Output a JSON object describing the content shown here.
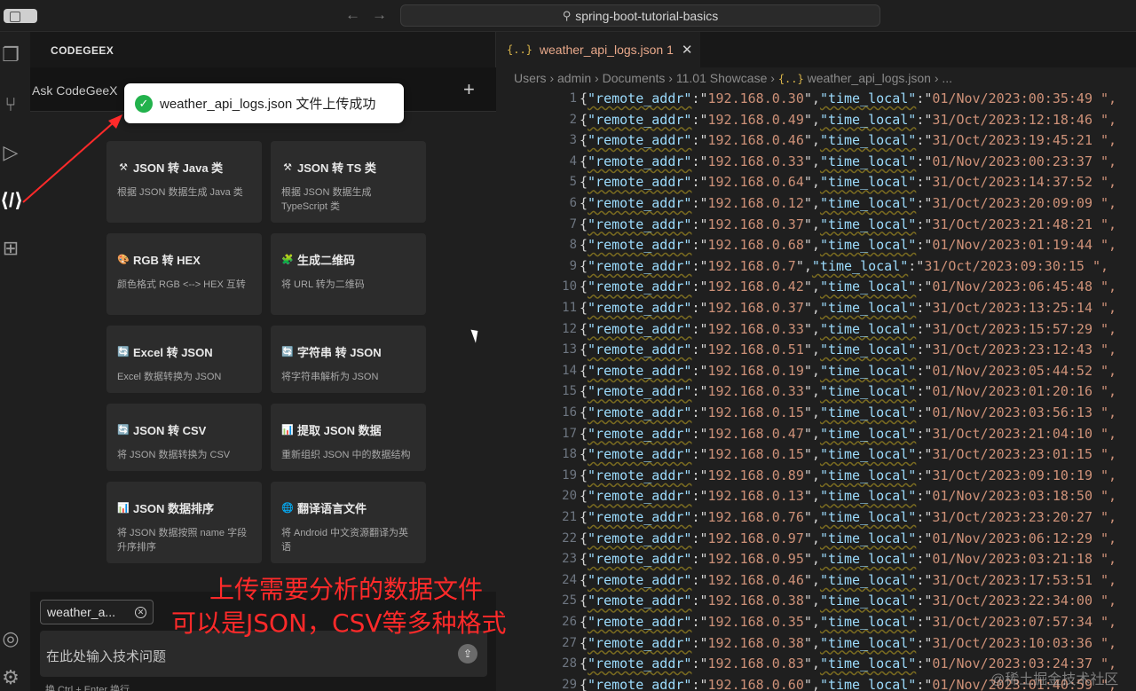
{
  "titlebar": {
    "search_text": "spring-boot-tutorial-basics",
    "back_icon": "arrow-left-icon",
    "forward_icon": "arrow-right-icon"
  },
  "sidebar": {
    "title": "CODEGEEX",
    "ask_label": "Ask CodeGeeX",
    "new_chat": "+"
  },
  "toast": {
    "message": "weather_api_logs.json 文件上传成功",
    "icon": "check-circle-icon"
  },
  "cards": [
    {
      "icon": "⚒",
      "title": "JSON 转 Java 类",
      "desc": "根据 JSON 数据生成 Java 类"
    },
    {
      "icon": "⚒",
      "title": "JSON 转 TS 类",
      "desc": "根据 JSON 数据生成 TypeScript 类"
    },
    {
      "icon": "🎨",
      "title": "RGB 转 HEX",
      "desc": "颜色格式 RGB <--> HEX 互转"
    },
    {
      "icon": "🧩",
      "title": "生成二维码",
      "desc": "将 URL 转为二维码"
    },
    {
      "icon": "🔄",
      "title": "Excel 转 JSON",
      "desc": "Excel 数据转换为 JSON"
    },
    {
      "icon": "🔄",
      "title": "字符串 转 JSON",
      "desc": "将字符串解析为 JSON"
    },
    {
      "icon": "🔄",
      "title": "JSON 转 CSV",
      "desc": "将 JSON 数据转换为 CSV"
    },
    {
      "icon": "📊",
      "title": "提取 JSON 数据",
      "desc": "重新组织 JSON 中的数据结构"
    },
    {
      "icon": "📊",
      "title": "JSON 数据排序",
      "desc": "将 JSON 数据按照 name 字段升序排序"
    },
    {
      "icon": "🌐",
      "title": "翻译语言文件",
      "desc": "将 Android 中文资源翻译为英语"
    }
  ],
  "input": {
    "file_chip": "weather_a...",
    "placeholder": "在此处输入技术问题",
    "hint": "换 Ctrl + Enter 换行"
  },
  "overlay": {
    "line1": "上传需要分析的数据文件",
    "line2": "可以是JSON，CSV等多种格式"
  },
  "editor": {
    "tab_label": "weather_api_logs.json 1",
    "breadcrumb": [
      "Users",
      "admin",
      "Documents",
      "11.01 Showcase",
      "weather_api_logs.json",
      "..."
    ],
    "lines": [
      {
        "n": "1",
        "addr": "192.168.0.30",
        "time": "01/Nov/2023:00:35:49"
      },
      {
        "n": "2",
        "addr": "192.168.0.49",
        "time": "31/Oct/2023:12:18:46"
      },
      {
        "n": "3",
        "addr": "192.168.0.46",
        "time": "31/Oct/2023:19:45:21"
      },
      {
        "n": "4",
        "addr": "192.168.0.33",
        "time": "01/Nov/2023:00:23:37"
      },
      {
        "n": "5",
        "addr": "192.168.0.64",
        "time": "31/Oct/2023:14:37:52"
      },
      {
        "n": "6",
        "addr": "192.168.0.12",
        "time": "31/Oct/2023:20:09:09"
      },
      {
        "n": "7",
        "addr": "192.168.0.37",
        "time": "31/Oct/2023:21:48:21"
      },
      {
        "n": "8",
        "addr": "192.168.0.68",
        "time": "01/Nov/2023:01:19:44"
      },
      {
        "n": "9",
        "addr": "192.168.0.7",
        "time": "31/Oct/2023:09:30:15"
      },
      {
        "n": "10",
        "addr": "192.168.0.42",
        "time": "01/Nov/2023:06:45:48"
      },
      {
        "n": "11",
        "addr": "192.168.0.37",
        "time": "31/Oct/2023:13:25:14"
      },
      {
        "n": "12",
        "addr": "192.168.0.33",
        "time": "31/Oct/2023:15:57:29"
      },
      {
        "n": "13",
        "addr": "192.168.0.51",
        "time": "31/Oct/2023:23:12:43"
      },
      {
        "n": "14",
        "addr": "192.168.0.19",
        "time": "01/Nov/2023:05:44:52"
      },
      {
        "n": "15",
        "addr": "192.168.0.33",
        "time": "01/Nov/2023:01:20:16"
      },
      {
        "n": "16",
        "addr": "192.168.0.15",
        "time": "01/Nov/2023:03:56:13"
      },
      {
        "n": "17",
        "addr": "192.168.0.47",
        "time": "31/Oct/2023:21:04:10"
      },
      {
        "n": "18",
        "addr": "192.168.0.15",
        "time": "31/Oct/2023:23:01:15"
      },
      {
        "n": "19",
        "addr": "192.168.0.89",
        "time": "31/Oct/2023:09:10:19"
      },
      {
        "n": "20",
        "addr": "192.168.0.13",
        "time": "01/Nov/2023:03:18:50"
      },
      {
        "n": "21",
        "addr": "192.168.0.76",
        "time": "31/Oct/2023:23:20:27"
      },
      {
        "n": "22",
        "addr": "192.168.0.97",
        "time": "01/Nov/2023:06:12:29"
      },
      {
        "n": "23",
        "addr": "192.168.0.95",
        "time": "01/Nov/2023:03:21:18"
      },
      {
        "n": "24",
        "addr": "192.168.0.46",
        "time": "31/Oct/2023:17:53:51"
      },
      {
        "n": "25",
        "addr": "192.168.0.38",
        "time": "31/Oct/2023:22:34:00"
      },
      {
        "n": "26",
        "addr": "192.168.0.35",
        "time": "31/Oct/2023:07:57:34"
      },
      {
        "n": "27",
        "addr": "192.168.0.38",
        "time": "31/Oct/2023:10:03:36"
      },
      {
        "n": "28",
        "addr": "192.168.0.83",
        "time": "01/Nov/2023:03:24:37"
      },
      {
        "n": "29",
        "addr": "192.168.0.60",
        "time": "01/Nov/2023:01:40:59"
      }
    ]
  },
  "watermark": "@稀土掘金技术社区",
  "colors": {
    "accent_red": "#ff2a2a",
    "success_green": "#22b24c",
    "json_key": "#9cdcfe",
    "json_string": "#ce9178"
  }
}
